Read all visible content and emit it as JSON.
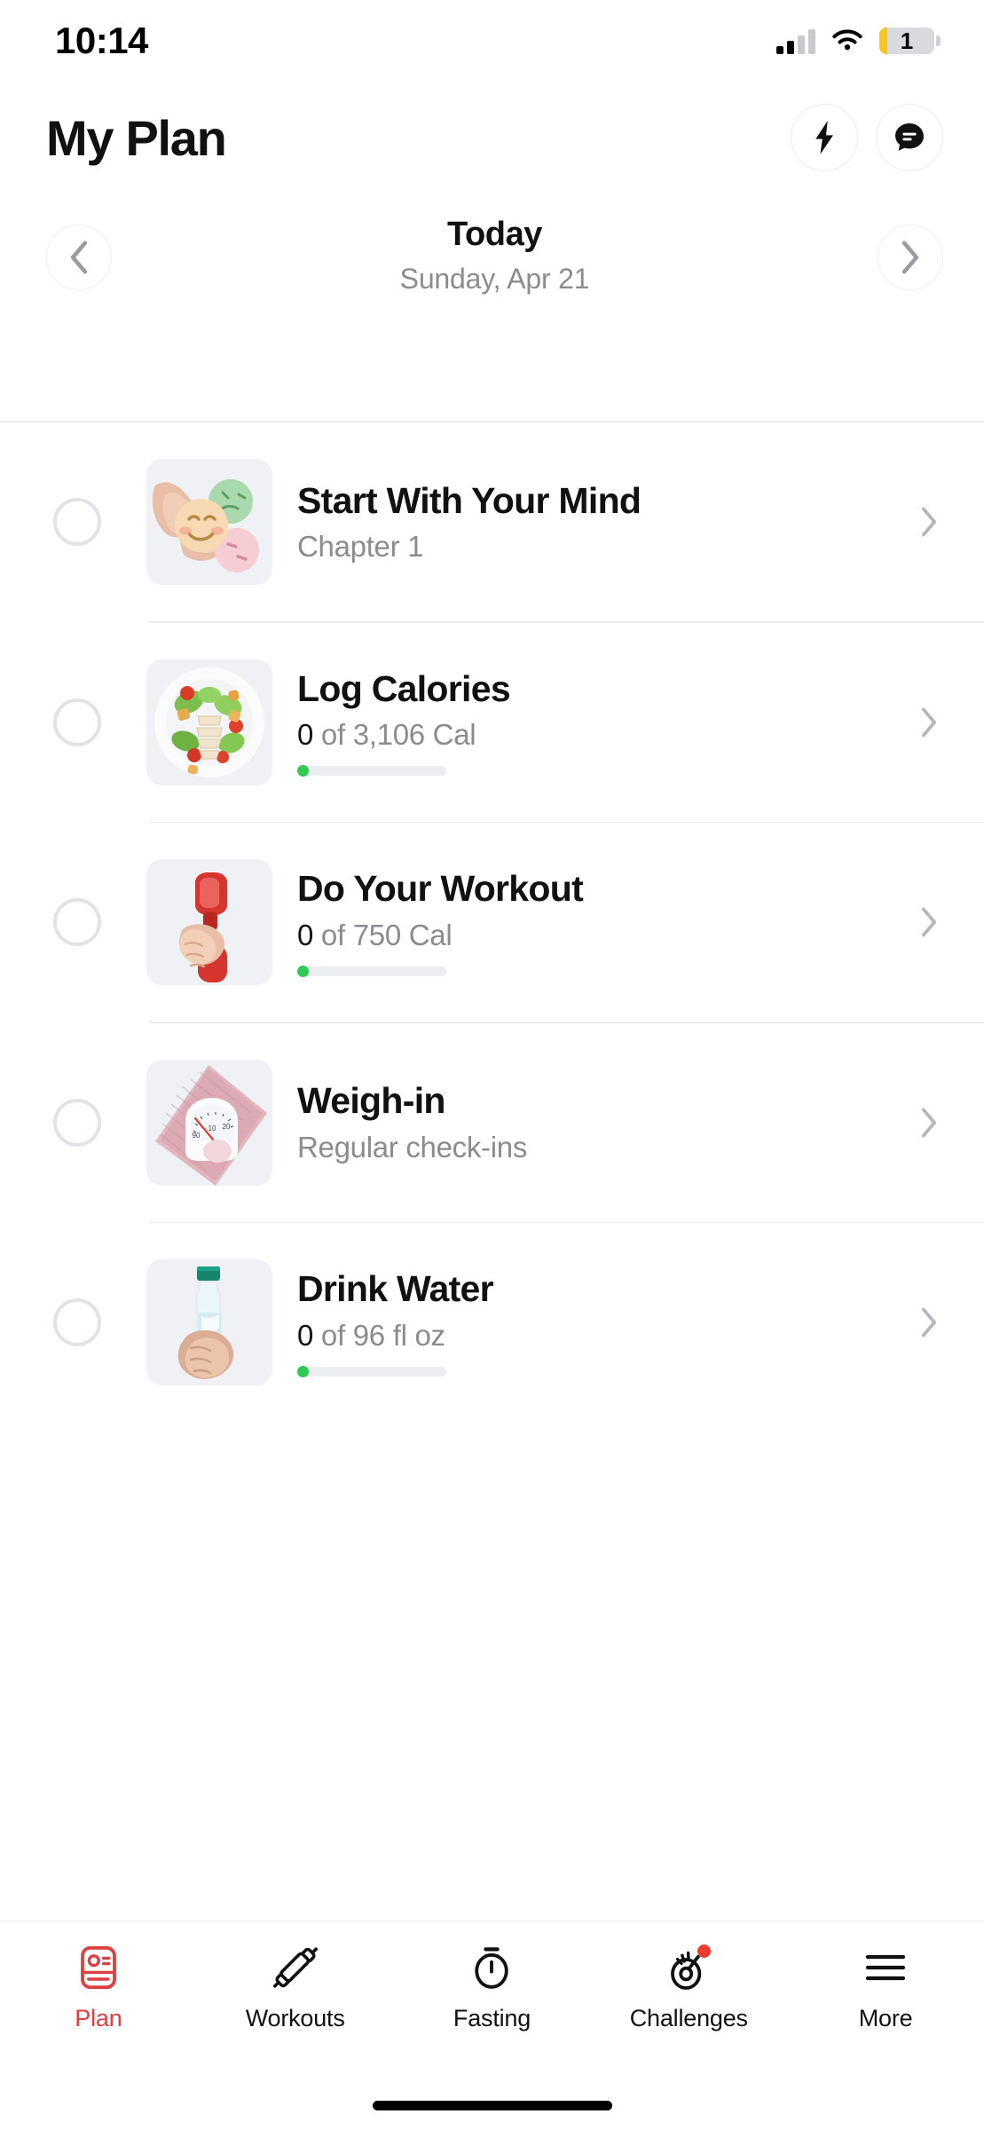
{
  "status_bar": {
    "time": "10:14",
    "signal_icon": "cellular-signal-icon",
    "wifi_icon": "wifi-icon",
    "battery_level": "1",
    "battery_icon": "battery-low-icon"
  },
  "header": {
    "title": "My Plan",
    "actions": [
      {
        "name": "lightning-bolt-button",
        "icon": "lightning-bolt-icon"
      },
      {
        "name": "chat-button",
        "icon": "chat-bubble-icon"
      }
    ]
  },
  "date_nav": {
    "prev_icon": "chevron-left-icon",
    "next_icon": "chevron-right-icon",
    "label": "Today",
    "sublabel": "Sunday, Apr 21"
  },
  "tasks": [
    {
      "checkbox": "unchecked",
      "thumb_icon": "hands-holding-emoji-faces-image",
      "title": "Start With Your Mind",
      "subtitle": "Chapter 1",
      "has_progress": false,
      "chevron": "chevron-right-icon"
    },
    {
      "checkbox": "unchecked",
      "thumb_icon": "salad-plate-image",
      "title": "Log Calories",
      "current": "0",
      "subtitle": " of 3,106 Cal",
      "has_progress": true,
      "progress_percent": 0,
      "chevron": "chevron-right-icon"
    },
    {
      "checkbox": "unchecked",
      "thumb_icon": "hand-holding-dumbbell-image",
      "title": "Do Your Workout",
      "current": "0",
      "subtitle": " of 750 Cal",
      "has_progress": true,
      "progress_percent": 0,
      "chevron": "chevron-right-icon"
    },
    {
      "checkbox": "unchecked",
      "thumb_icon": "pink-bathroom-scale-image",
      "title": "Weigh-in",
      "subtitle": "Regular check-ins",
      "has_progress": false,
      "chevron": "chevron-right-icon"
    },
    {
      "checkbox": "unchecked",
      "thumb_icon": "hand-holding-water-bottle-image",
      "title": "Drink Water",
      "current": "0",
      "subtitle": " of 96 fl oz",
      "has_progress": true,
      "progress_percent": 0,
      "chevron": "chevron-right-icon"
    }
  ],
  "tabbar": {
    "items": [
      {
        "label": "Plan",
        "icon": "plan-card-icon",
        "active": true,
        "badge": false
      },
      {
        "label": "Workouts",
        "icon": "dumbbell-icon",
        "active": false,
        "badge": false
      },
      {
        "label": "Fasting",
        "icon": "stopwatch-icon",
        "active": false,
        "badge": false
      },
      {
        "label": "Challenges",
        "icon": "target-icon",
        "active": false,
        "badge": true
      },
      {
        "label": "More",
        "icon": "hamburger-menu-icon",
        "active": false,
        "badge": false
      }
    ]
  },
  "colors": {
    "accent": "#dc4040",
    "progress_green": "#2fc956",
    "badge_red": "#ef3b2d",
    "battery_yellow": "#f5c518",
    "muted_text": "#8b8b90"
  }
}
